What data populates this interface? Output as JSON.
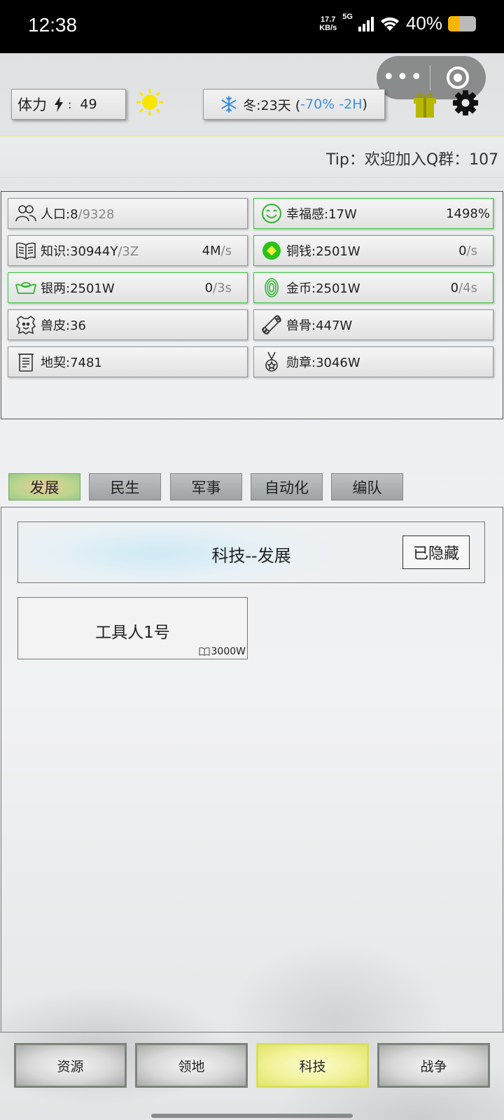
{
  "status_bar": {
    "time": "12:38",
    "net_speed_top": "17.7",
    "net_speed_bottom": "KB/s",
    "network": "5G",
    "battery": "40%"
  },
  "capsule": {
    "more": "•••"
  },
  "top": {
    "stamina_label": "体力",
    "stamina_sep": ":",
    "stamina_value": "49",
    "season_text": "冬:23天 (",
    "season_effect": "-70% -2H",
    "season_close": ")"
  },
  "tip": {
    "text": "Tip：欢迎加入Q群：107"
  },
  "resources": [
    {
      "name": "人口:8",
      "extra": "/9328",
      "rate": "",
      "rate_unit": "",
      "icon": "people-icon"
    },
    {
      "name": "幸福感:17W",
      "extra": "",
      "rate": "1498%",
      "rate_unit": "",
      "icon": "smile-icon"
    },
    {
      "name": "知识:30944Y",
      "extra": "/3Z",
      "rate": "4M",
      "rate_unit": "/s",
      "icon": "book-icon"
    },
    {
      "name": "铜钱:2501W",
      "extra": "",
      "rate": "0",
      "rate_unit": "/s",
      "icon": "copper-coin-icon"
    },
    {
      "name": "银两:2501W",
      "extra": "",
      "rate": "0",
      "rate_unit": "/3s",
      "icon": "silver-ingot-icon"
    },
    {
      "name": "金币:2501W",
      "extra": "",
      "rate": "0",
      "rate_unit": "/4s",
      "icon": "gold-coin-icon"
    },
    {
      "name": "兽皮:36",
      "extra": "",
      "rate": "",
      "rate_unit": "",
      "icon": "hide-icon"
    },
    {
      "name": "兽骨:447W",
      "extra": "",
      "rate": "",
      "rate_unit": "",
      "icon": "bone-icon"
    },
    {
      "name": "地契:7481",
      "extra": "",
      "rate": "",
      "rate_unit": "",
      "icon": "deed-icon"
    },
    {
      "name": "勋章:3046W",
      "extra": "",
      "rate": "",
      "rate_unit": "",
      "icon": "medal-icon"
    }
  ],
  "tabs": [
    "发展",
    "民生",
    "军事",
    "自动化",
    "编队"
  ],
  "active_tab": "发展",
  "tech": {
    "title": "科技--发展",
    "hidden_button": "已隐藏",
    "card_name": "工具人1号",
    "card_cost": "3000W"
  },
  "bottom_nav": [
    "资源",
    "领地",
    "科技",
    "战争"
  ],
  "active_nav": "科技",
  "colors": {
    "active_nav": "#f2f29a",
    "green_border": "#3ec73e",
    "season_blue": "#3a8ee6"
  }
}
